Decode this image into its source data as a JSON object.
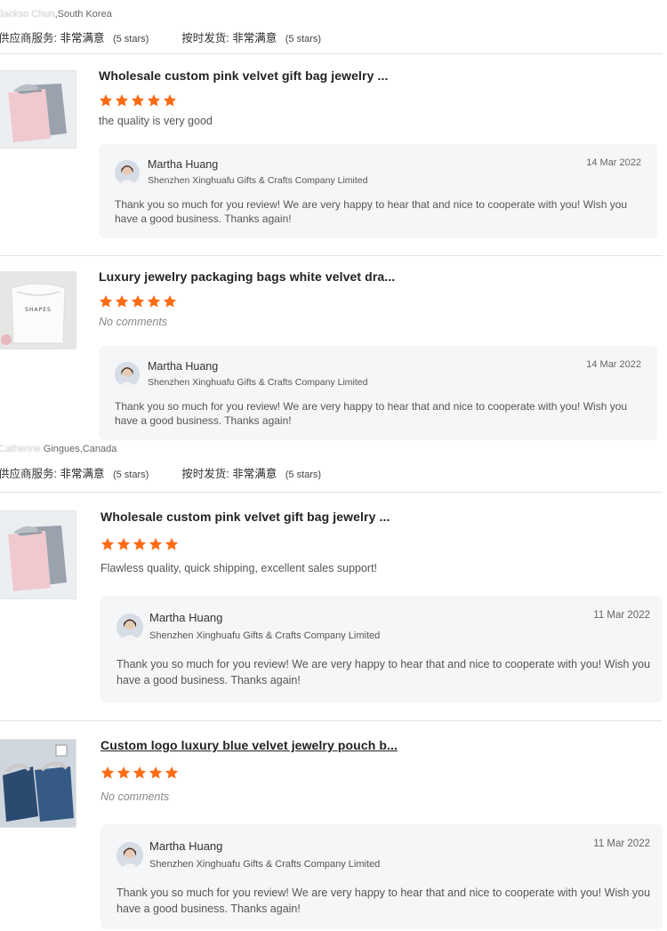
{
  "reviews_top": {
    "buyer": {
      "name_blurred": "Jackso Chun",
      "location": ",South Korea"
    },
    "supplier_service": {
      "label": "供应商服务:",
      "value": "非常满意",
      "stars": "(5 stars)"
    },
    "on_time_delivery": {
      "label": "按时发货:",
      "value": "非常满意",
      "stars": "(5 stars)"
    }
  },
  "reviews_mid": {
    "buyer": {
      "name_blurred": "Catherine",
      "location": " Gingues,Canada"
    },
    "supplier_service": {
      "label": "供应商服务:",
      "value": "非常满意",
      "stars": "(5 stars)"
    },
    "on_time_delivery": {
      "label": "按时发货:",
      "value": "非常满意",
      "stars": "(5 stars)"
    }
  },
  "items": [
    {
      "title": "Wholesale custom pink velvet gift bag jewelry ...",
      "rating": 5,
      "comment": "the quality is very good",
      "reply": {
        "name": "Martha Huang",
        "company": "Shenzhen Xinghuafu Gifts & Crafts Company Limited",
        "date": "14 Mar 2022",
        "text": "Thank you so much for you review! We are very happy to hear that and nice to cooperate with you! Wish you have a good business. Thanks again!"
      }
    },
    {
      "title": "Luxury jewelry packaging bags white velvet dra...",
      "rating": 5,
      "comment": "No comments",
      "thumb_text": "SHAPES",
      "reply": {
        "name": "Martha Huang",
        "company": "Shenzhen Xinghuafu Gifts & Crafts Company Limited",
        "date": "14 Mar 2022",
        "text": "Thank you so much for you review! We are very happy to hear that and nice to cooperate with you! Wish you have a good business. Thanks again!"
      }
    },
    {
      "title": "Wholesale custom pink velvet gift bag jewelry ...",
      "rating": 5,
      "comment": "Flawless quality, quick shipping, excellent sales support!",
      "reply": {
        "name": "Martha Huang",
        "company": "Shenzhen Xinghuafu Gifts & Crafts Company Limited",
        "date": "11 Mar 2022",
        "text": "Thank you so much for you review! We are very happy to hear that and nice to cooperate with you! Wish you have a good business. Thanks again!"
      }
    },
    {
      "title": "Custom logo luxury blue velvet jewelry pouch b...",
      "rating": 5,
      "comment": "No comments",
      "reply": {
        "name": "Martha Huang",
        "company": "Shenzhen Xinghuafu Gifts & Crafts Company Limited",
        "date": "11 Mar 2022",
        "text": "Thank you so much for you review! We are very happy to hear that and nice to cooperate with you! Wish you have a good business. Thanks again!"
      }
    }
  ],
  "colors": {
    "star": "#ff6a14",
    "reply_bg": "#f5f6f8",
    "divider": "#e4e4e4"
  }
}
